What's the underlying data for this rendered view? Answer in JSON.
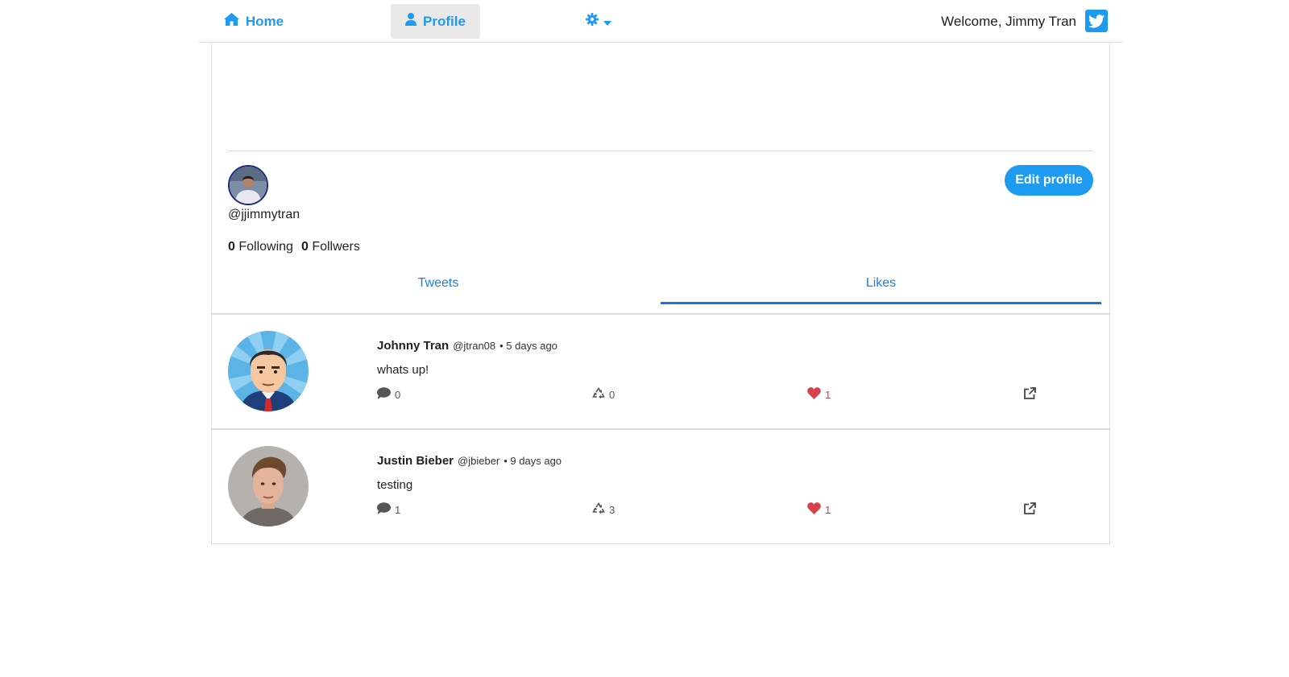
{
  "nav": {
    "home_label": "Home",
    "profile_label": "Profile",
    "welcome_text": "Welcome, Jimmy Tran",
    "accent_color": "#1d9bf0"
  },
  "profile": {
    "handle": "@jjimmytran",
    "following_count": "0",
    "following_label": "Following",
    "followers_count": "0",
    "followers_label": "Follwers",
    "edit_button_label": "Edit profile",
    "tabs": [
      {
        "label": "Tweets",
        "active": false
      },
      {
        "label": "Likes",
        "active": true
      }
    ]
  },
  "tweets": [
    {
      "author": "Johnny Tran",
      "handle": "@jtran08",
      "time": "• 5 days ago",
      "text": "whats up!",
      "replies": "0",
      "retweets": "0",
      "likes": "1"
    },
    {
      "author": "Justin Bieber",
      "handle": "@jbieber",
      "time": "• 9 days ago",
      "text": "testing",
      "replies": "1",
      "retweets": "3",
      "likes": "1"
    }
  ]
}
